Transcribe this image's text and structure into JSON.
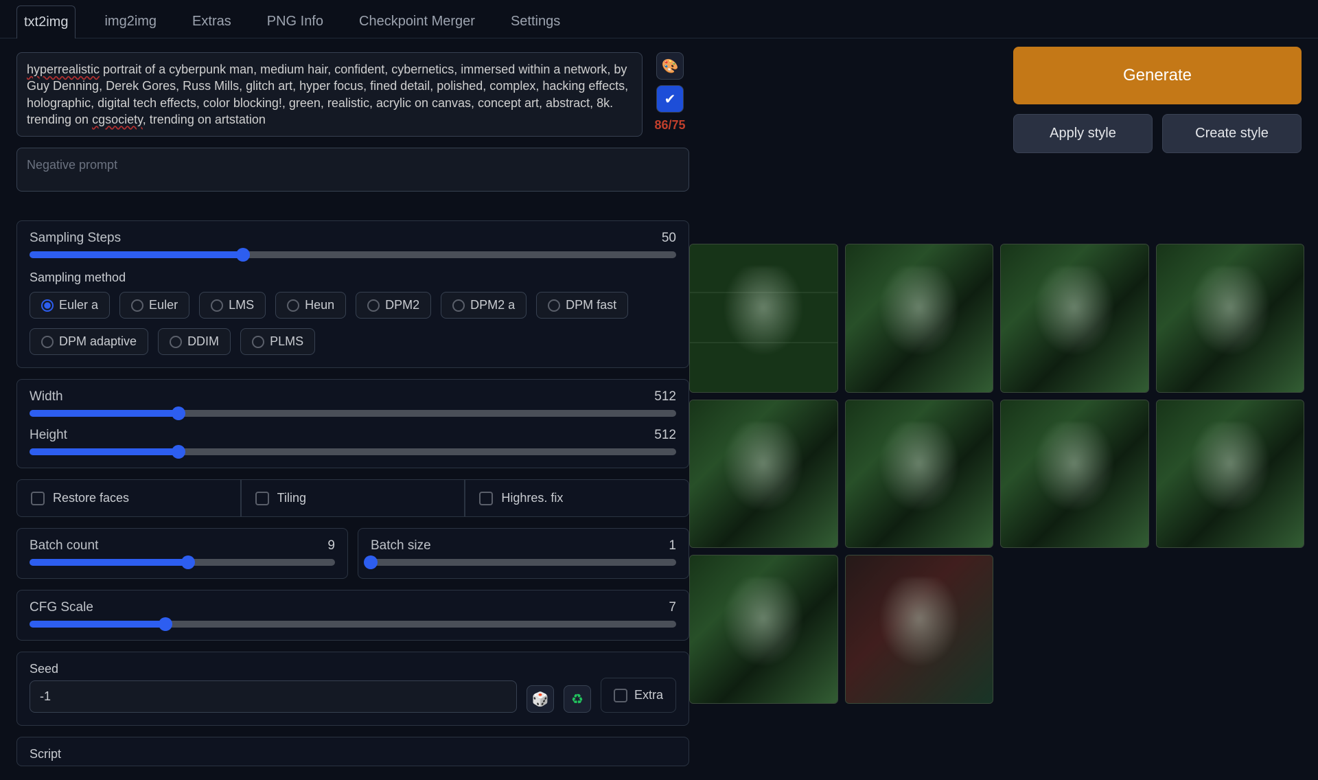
{
  "tabs": [
    "txt2img",
    "img2img",
    "Extras",
    "PNG Info",
    "Checkpoint Merger",
    "Settings"
  ],
  "active_tab": 0,
  "prompt": {
    "text_pre": "hyperrealistic",
    "text_mid": " portrait of a cyberpunk man, medium hair, confident, cybernetics, immersed within a network, by Guy Denning, Derek Gores, Russ Mills, glitch art, hyper focus, fined detail, polished, complex, hacking effects, holographic, digital tech effects, color blocking!, green, realistic, acrylic on canvas, concept art, abstract, 8k. trending on ",
    "text_wave2": "cgsociety",
    "text_post": ", trending on artstation",
    "token_count": "86/75"
  },
  "neg_prompt_placeholder": "Negative prompt",
  "buttons": {
    "generate": "Generate",
    "apply_style": "Apply style",
    "create_style": "Create style",
    "palette_icon": "🎨",
    "check_icon": "✔"
  },
  "sampling": {
    "steps_label": "Sampling Steps",
    "steps_value": "50",
    "steps_pct": 33,
    "method_label": "Sampling method",
    "methods": [
      "Euler a",
      "Euler",
      "LMS",
      "Heun",
      "DPM2",
      "DPM2 a",
      "DPM fast",
      "DPM adaptive",
      "DDIM",
      "PLMS"
    ],
    "selected": 0
  },
  "dims": {
    "width_label": "Width",
    "width_value": "512",
    "width_pct": 23,
    "height_label": "Height",
    "height_value": "512",
    "height_pct": 23
  },
  "checks": {
    "restore": "Restore faces",
    "tiling": "Tiling",
    "highres": "Highres. fix"
  },
  "batch": {
    "count_label": "Batch count",
    "count_value": "9",
    "count_pct": 52,
    "size_label": "Batch size",
    "size_value": "1",
    "size_pct": 0
  },
  "cfg": {
    "label": "CFG Scale",
    "value": "7",
    "pct": 21
  },
  "seed": {
    "label": "Seed",
    "value": "-1",
    "dice": "🎲",
    "recycle": "♻",
    "extra": "Extra"
  },
  "script_label": "Script",
  "gallery_count": 10
}
